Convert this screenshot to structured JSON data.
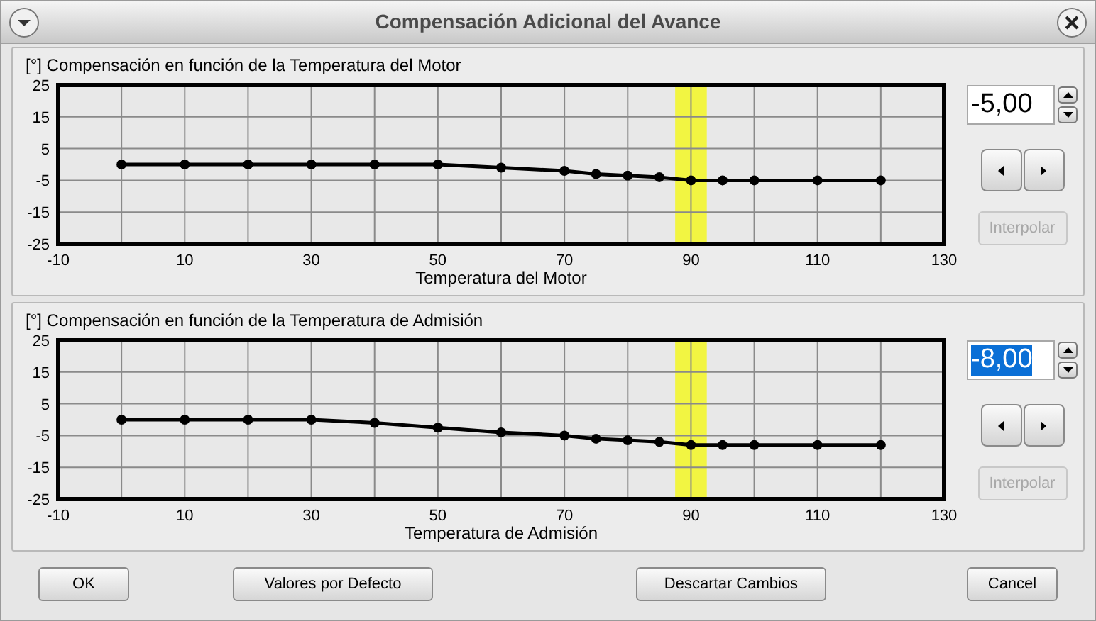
{
  "window": {
    "title": "Compensación Adicional del Avance"
  },
  "panels": [
    {
      "chart_data": {
        "type": "line",
        "title": "[°] Compensación en función de la Temperatura del Motor",
        "xlabel": "Temperatura del Motor",
        "x": [
          0,
          10,
          20,
          30,
          40,
          50,
          60,
          70,
          75,
          80,
          85,
          90,
          95,
          100,
          110,
          120
        ],
        "series": [
          {
            "color": "#000000",
            "marker": true,
            "values": [
              0,
              0,
              0,
              0,
              0,
              0,
              -1,
              -2,
              -3,
              -3.5,
              -4,
              -5,
              -5,
              -5,
              -5,
              -5
            ]
          }
        ],
        "xlim": [
          -10,
          130
        ],
        "ylim": [
          -25,
          25
        ],
        "xticks": [
          -10,
          10,
          30,
          50,
          70,
          90,
          110,
          130
        ],
        "yticks": [
          25,
          15,
          5,
          -5,
          -15,
          -25
        ],
        "grid": true,
        "bands": [
          {
            "axis": "x",
            "from": 87.5,
            "to": 92.5,
            "color": "#f2f542"
          }
        ]
      },
      "field": {
        "value": "-5,00",
        "selected": false
      },
      "interpolate_button": {
        "label": "Interpolar",
        "disabled": true
      }
    },
    {
      "chart_data": {
        "type": "line",
        "title": "[°] Compensación en función de la Temperatura de Admisión",
        "xlabel": "Temperatura de Admisión",
        "x": [
          0,
          10,
          20,
          30,
          40,
          50,
          60,
          70,
          75,
          80,
          85,
          90,
          95,
          100,
          110,
          120
        ],
        "series": [
          {
            "color": "#000000",
            "marker": true,
            "values": [
              0,
              0,
              0,
              0,
              -1,
              -2.5,
              -4,
              -5,
              -6,
              -6.5,
              -7,
              -8,
              -8,
              -8,
              -8,
              -8
            ]
          }
        ],
        "xlim": [
          -10,
          130
        ],
        "ylim": [
          -25,
          25
        ],
        "xticks": [
          -10,
          10,
          30,
          50,
          70,
          90,
          110,
          130
        ],
        "yticks": [
          25,
          15,
          5,
          -5,
          -15,
          -25
        ],
        "grid": true,
        "bands": [
          {
            "axis": "x",
            "from": 87.5,
            "to": 92.5,
            "color": "#f2f542"
          }
        ]
      },
      "field": {
        "value": "-8,00",
        "selected": true
      },
      "interpolate_button": {
        "label": "Interpolar",
        "disabled": true
      }
    }
  ],
  "buttons": [
    {
      "label": "OK"
    },
    {
      "label": "Valores por Defecto"
    },
    {
      "label": "Descartar Cambios"
    },
    {
      "label": "Cancel"
    }
  ]
}
